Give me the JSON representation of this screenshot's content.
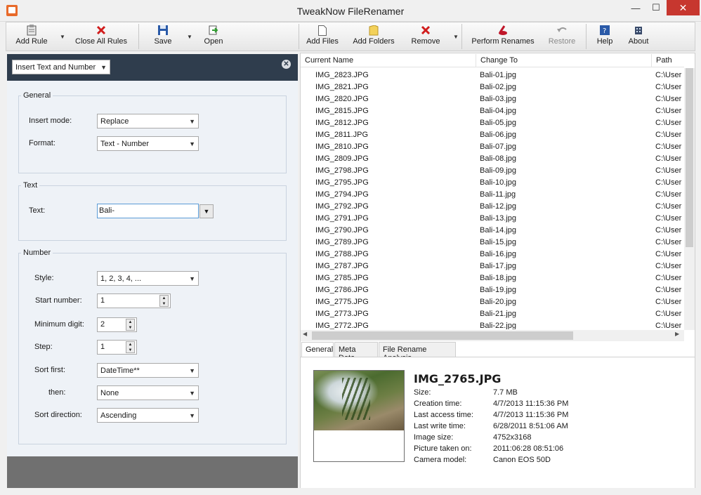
{
  "window": {
    "title": "TweakNow FileRenamer",
    "min": "—",
    "max": "☐",
    "close": "✕"
  },
  "toolbar": {
    "add_rule": "Add Rule",
    "close_all_rules": "Close All Rules",
    "save": "Save",
    "open": "Open",
    "add_files": "Add Files",
    "add_folders": "Add Folders",
    "remove": "Remove",
    "perform_renames": "Perform Renames",
    "restore": "Restore",
    "help": "Help",
    "about": "About"
  },
  "rule": {
    "selected": "Insert Text and Number",
    "general": {
      "title": "General",
      "insert_mode_label": "Insert mode:",
      "insert_mode_value": "Replace",
      "format_label": "Format:",
      "format_value": "Text - Number"
    },
    "text": {
      "title": "Text",
      "text_label": "Text:",
      "text_value": "Bali-"
    },
    "number": {
      "title": "Number",
      "style_label": "Style:",
      "style_value": "1, 2, 3, 4, ...",
      "start_label": "Start number:",
      "start_value": "1",
      "min_digit_label": "Minimum digit:",
      "min_digit_value": "2",
      "step_label": "Step:",
      "step_value": "1",
      "sort_first_label": "Sort first:",
      "sort_first_value": "DateTime**",
      "then_label": "then:",
      "then_value": "None",
      "sort_dir_label": "Sort direction:",
      "sort_dir_value": "Ascending"
    }
  },
  "file_list": {
    "columns": {
      "current": "Current Name",
      "change": "Change To",
      "path": "Path"
    },
    "path_value": "C:\\User",
    "rows": [
      {
        "current": "IMG_2823.JPG",
        "change": "Bali-01.jpg"
      },
      {
        "current": "IMG_2821.JPG",
        "change": "Bali-02.jpg"
      },
      {
        "current": "IMG_2820.JPG",
        "change": "Bali-03.jpg"
      },
      {
        "current": "IMG_2815.JPG",
        "change": "Bali-04.jpg"
      },
      {
        "current": "IMG_2812.JPG",
        "change": "Bali-05.jpg"
      },
      {
        "current": "IMG_2811.JPG",
        "change": "Bali-06.jpg"
      },
      {
        "current": "IMG_2810.JPG",
        "change": "Bali-07.jpg"
      },
      {
        "current": "IMG_2809.JPG",
        "change": "Bali-08.jpg"
      },
      {
        "current": "IMG_2798.JPG",
        "change": "Bali-09.jpg"
      },
      {
        "current": "IMG_2795.JPG",
        "change": "Bali-10.jpg"
      },
      {
        "current": "IMG_2794.JPG",
        "change": "Bali-11.jpg"
      },
      {
        "current": "IMG_2792.JPG",
        "change": "Bali-12.jpg"
      },
      {
        "current": "IMG_2791.JPG",
        "change": "Bali-13.jpg"
      },
      {
        "current": "IMG_2790.JPG",
        "change": "Bali-14.jpg"
      },
      {
        "current": "IMG_2789.JPG",
        "change": "Bali-15.jpg"
      },
      {
        "current": "IMG_2788.JPG",
        "change": "Bali-16.jpg"
      },
      {
        "current": "IMG_2787.JPG",
        "change": "Bali-17.jpg"
      },
      {
        "current": "IMG_2785.JPG",
        "change": "Bali-18.jpg"
      },
      {
        "current": "IMG_2786.JPG",
        "change": "Bali-19.jpg"
      },
      {
        "current": "IMG_2775.JPG",
        "change": "Bali-20.jpg"
      },
      {
        "current": "IMG_2773.JPG",
        "change": "Bali-21.jpg"
      },
      {
        "current": "IMG_2772.JPG",
        "change": "Bali-22.jpg"
      }
    ]
  },
  "tabs": [
    "General",
    "Meta Data",
    "File Rename Analysis"
  ],
  "details": {
    "filename": "IMG_2765.JPG",
    "props": [
      {
        "label": "Size:",
        "value": "7.7 MB"
      },
      {
        "label": "Creation time:",
        "value": "4/7/2013 11:15:36 PM"
      },
      {
        "label": "Last access time:",
        "value": "4/7/2013 11:15:36 PM"
      },
      {
        "label": "Last write time:",
        "value": "6/28/2011 8:51:06 AM"
      },
      {
        "label": "Image size:",
        "value": "4752x3168"
      },
      {
        "label": "Picture taken on:",
        "value": "2011:06:28 08:51:06"
      },
      {
        "label": "Camera model:",
        "value": "Canon EOS 50D"
      }
    ]
  },
  "colors": {
    "panel_header": "#2f3d4d",
    "close_button": "#c7372f",
    "form_bg": "#eef2f7"
  }
}
